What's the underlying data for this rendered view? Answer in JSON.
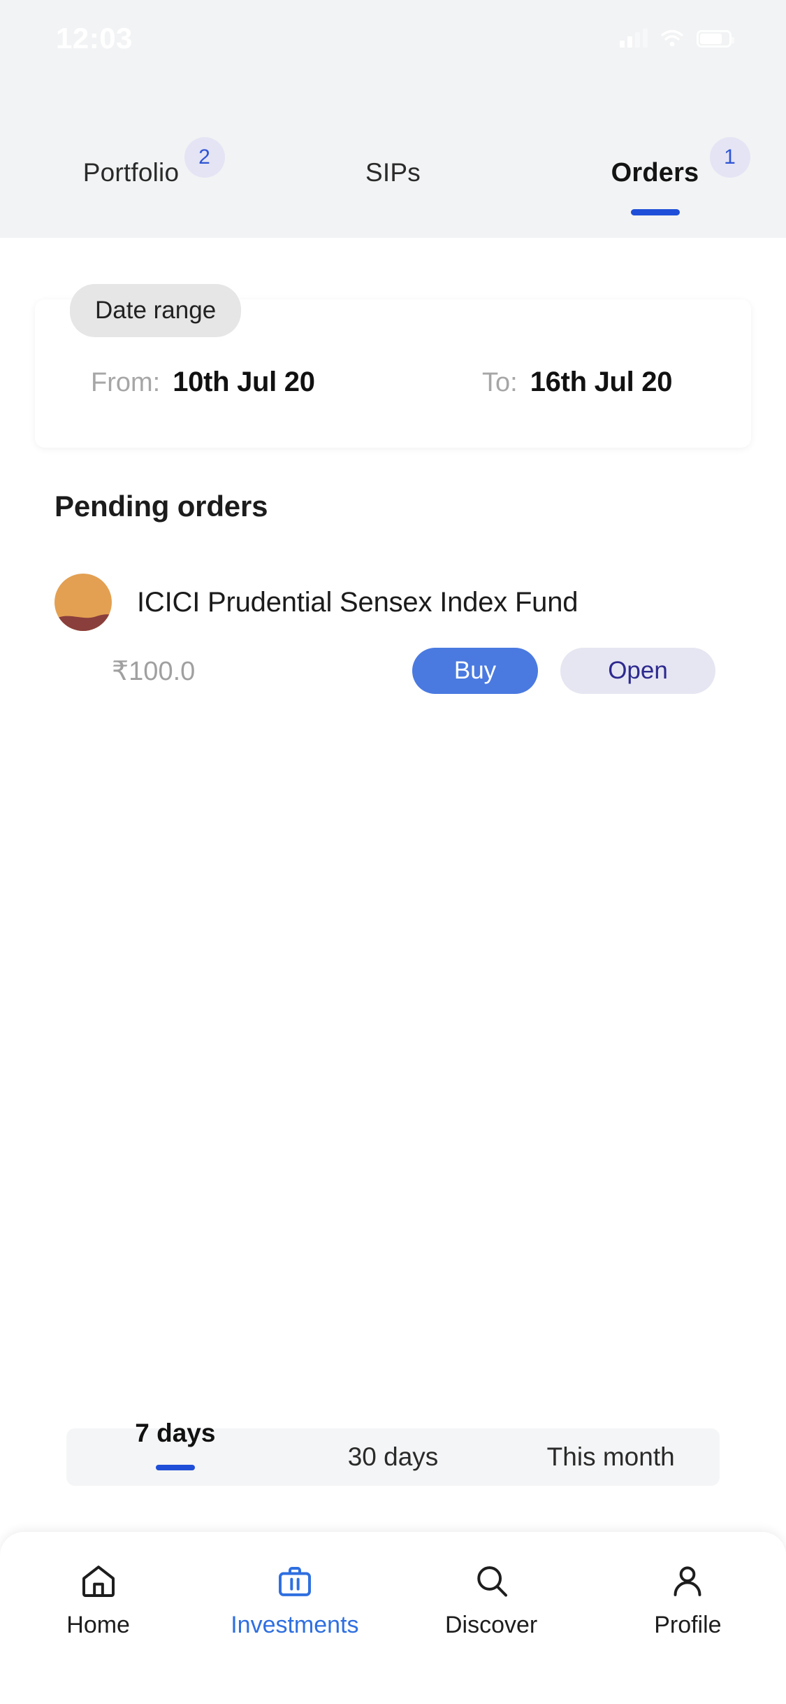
{
  "status_bar": {
    "time": "12:03",
    "icons": [
      "signal-icon",
      "wifi-icon",
      "battery-icon"
    ]
  },
  "tabs": [
    {
      "label": "Portfolio",
      "badge": "2",
      "active": false
    },
    {
      "label": "SIPs",
      "badge": "",
      "active": false
    },
    {
      "label": "Orders",
      "badge": "1",
      "active": true
    }
  ],
  "date_range": {
    "pill_label": "Date range",
    "from_label": "From:",
    "from_value": "10th Jul 20",
    "to_label": "To:",
    "to_value": "16th Jul 20"
  },
  "pending": {
    "title": "Pending orders",
    "orders": [
      {
        "fund_name": "ICICI Prudential Sensex Index Fund",
        "amount": "₹100.0",
        "primary_action": "Buy",
        "secondary_action": "Open",
        "icon": "icici-fund-icon"
      }
    ]
  },
  "range_filter": {
    "options": [
      {
        "label": "7 days",
        "active": true
      },
      {
        "label": "30 days",
        "active": false
      },
      {
        "label": "This month",
        "active": false
      }
    ]
  },
  "bottom_nav": [
    {
      "label": "Home",
      "icon": "home-icon",
      "active": false
    },
    {
      "label": "Investments",
      "icon": "briefcase-icon",
      "active": true
    },
    {
      "label": "Discover",
      "icon": "search-icon",
      "active": false
    },
    {
      "label": "Profile",
      "icon": "person-icon",
      "active": false
    }
  ],
  "colors": {
    "accent_blue": "#1f4fd8",
    "button_blue": "#4a7ae0",
    "badge_bg": "#e4e4f5",
    "open_bg": "#e6e6f2",
    "open_text": "#2e2a8f",
    "fund_orange": "#e3a052",
    "fund_maroon": "#8a3f3c",
    "page_gray": "#f2f3f4"
  }
}
